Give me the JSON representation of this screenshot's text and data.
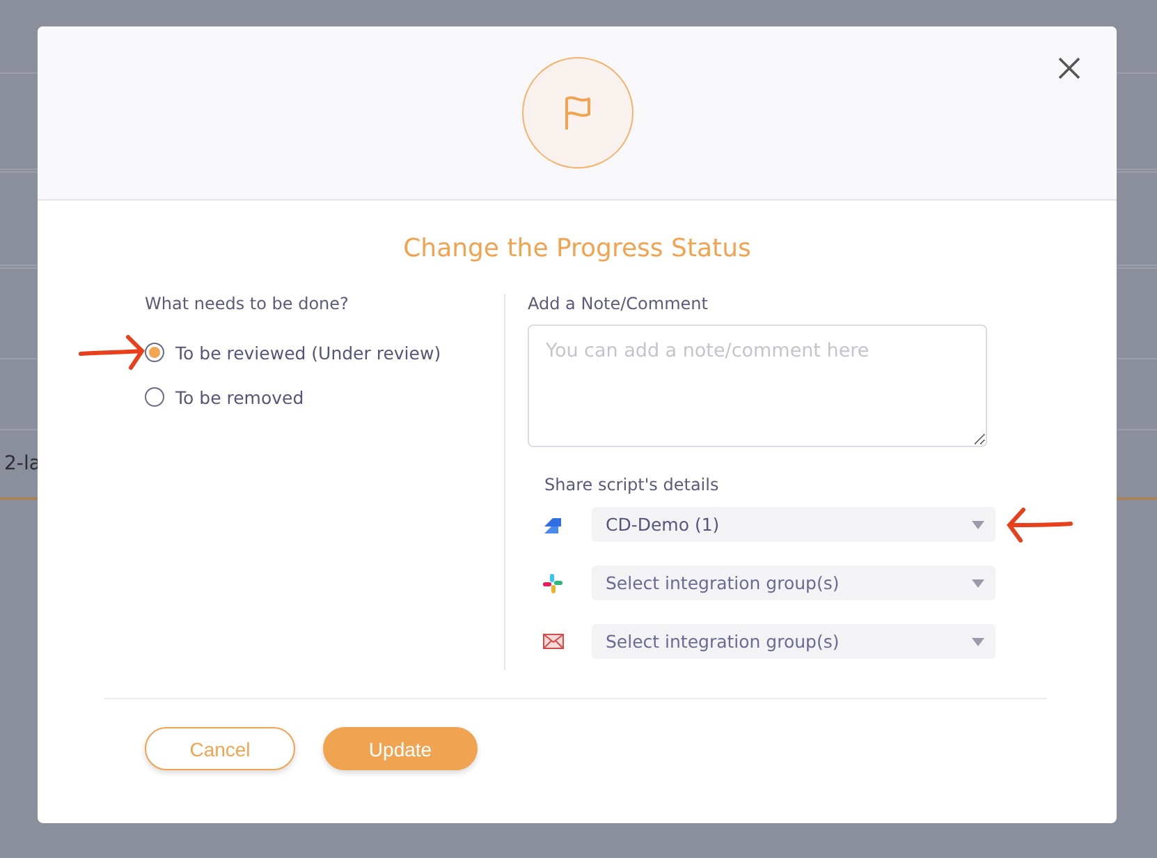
{
  "background": {
    "row_text": "2-la"
  },
  "dialog": {
    "title": "Change the Progress Status",
    "question": "What needs to be done?",
    "options": [
      {
        "label": "To be reviewed (Under review)",
        "selected": true
      },
      {
        "label": "To be removed",
        "selected": false
      }
    ],
    "note": {
      "label": "Add a Note/Comment",
      "placeholder": "You can add a note/comment here"
    },
    "share": {
      "label": "Share script's details",
      "integrations": [
        {
          "kind": "jira",
          "value": "CD-Demo (1)"
        },
        {
          "kind": "slack",
          "placeholder": "Select integration group(s)"
        },
        {
          "kind": "email",
          "placeholder": "Select integration group(s)"
        }
      ]
    },
    "buttons": [
      {
        "label": "Cancel",
        "kind": "secondary"
      },
      {
        "label": "Update",
        "kind": "primary"
      }
    ]
  }
}
